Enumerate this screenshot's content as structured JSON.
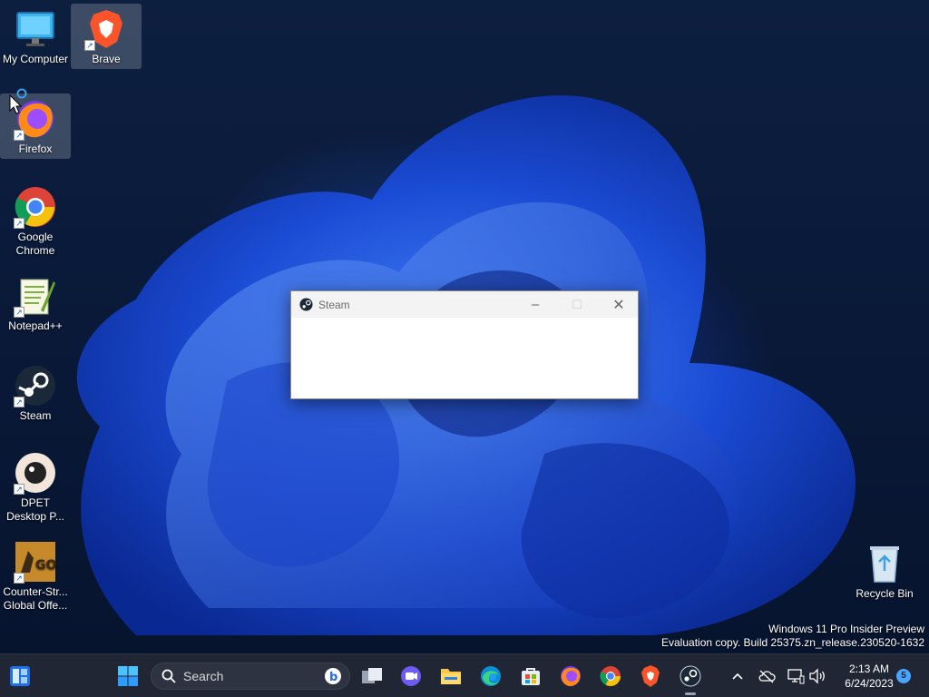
{
  "desktop": {
    "icons": [
      {
        "label": "My Computer"
      },
      {
        "label": "Brave"
      },
      {
        "label": "Firefox"
      },
      {
        "label": "Google Chrome"
      },
      {
        "label": "Notepad++"
      },
      {
        "label": "Steam"
      },
      {
        "label": "DPET Desktop P..."
      },
      {
        "label": "Counter-Str... Global Offe..."
      },
      {
        "label": "Recycle Bin"
      }
    ],
    "watermark": {
      "line1": "Windows 11 Pro Insider Preview",
      "line2": "Evaluation copy. Build 25375.zn_release.230520-1632"
    }
  },
  "steam_window": {
    "title": "Steam",
    "minimize": "–",
    "maximize": "☐",
    "close": "✕"
  },
  "taskbar": {
    "search_label": "Search",
    "clock_time": "2:13 AM",
    "clock_date": "6/24/2023",
    "notification_count": "5",
    "apps": [
      "Widgets",
      "Start",
      "Task View",
      "Chat",
      "File Explorer",
      "Edge",
      "Microsoft Store",
      "Firefox",
      "Chrome",
      "Brave",
      "Steam"
    ]
  },
  "colors": {
    "accent": "#2b6dff",
    "taskbar": "#202634",
    "brave": "#fb542b",
    "steam": "#1b2838"
  }
}
